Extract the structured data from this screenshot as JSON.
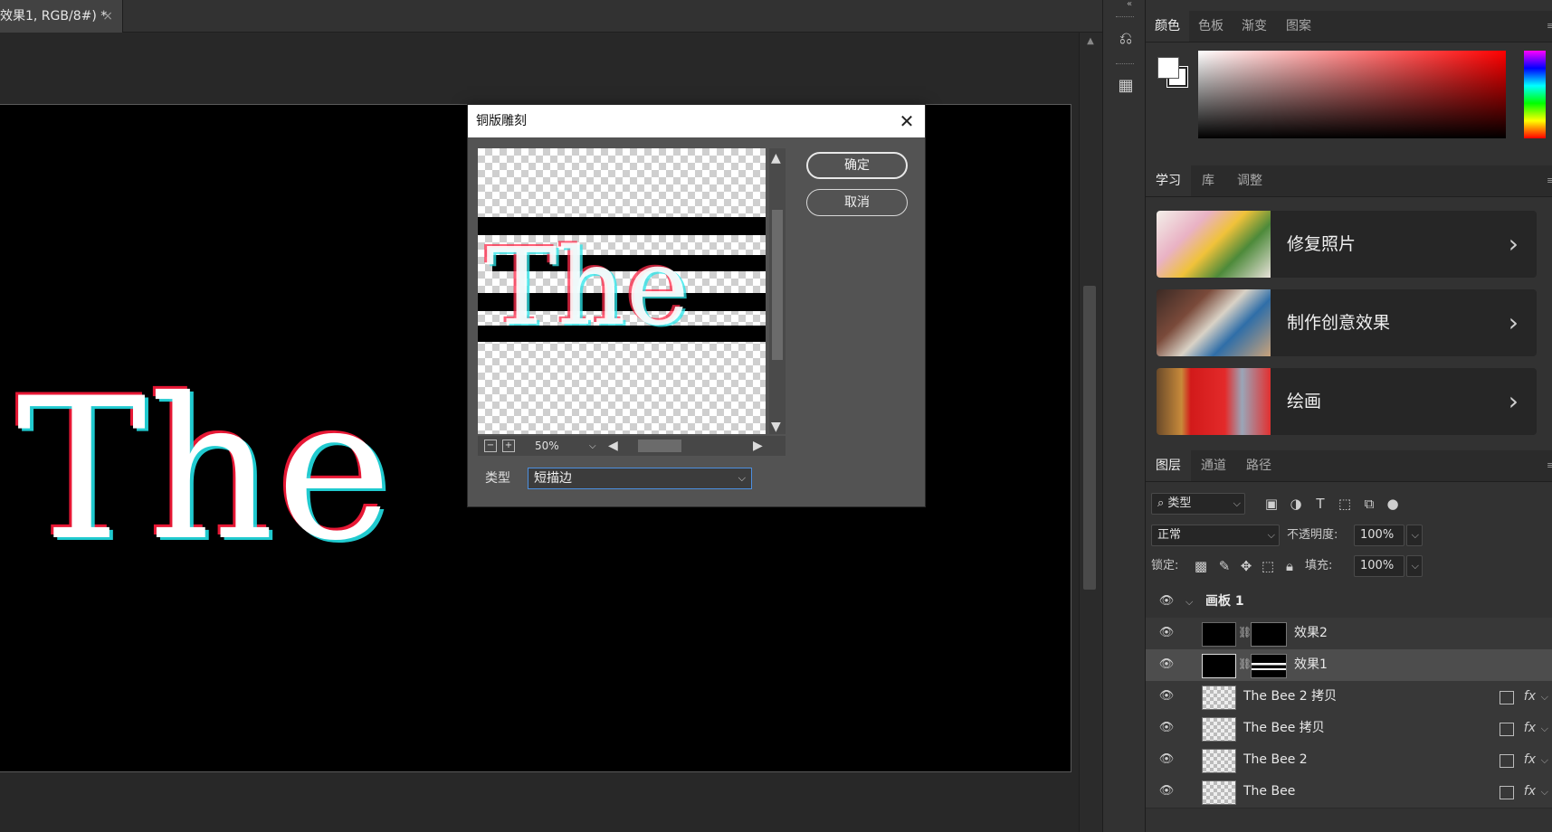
{
  "document": {
    "tab_title": "效果1, RGB/8#) *",
    "tab_close": "×",
    "canvas_text": "The"
  },
  "dialog": {
    "title": "铜版雕刻",
    "close_glyph": "✕",
    "ok_label": "确定",
    "cancel_label": "取消",
    "zoom": "50%",
    "type_label": "类型",
    "type_value": "短描边",
    "preview_text": "The"
  },
  "color_panel": {
    "tabs": [
      "颜色",
      "色板",
      "渐变",
      "图案"
    ],
    "foreground": "#ffffff",
    "background": "#ffffff"
  },
  "learn_panel": {
    "tabs": [
      "学习",
      "库",
      "调整"
    ],
    "cards": [
      {
        "label": "修复照片",
        "icon": "flower-bouquet-thumbnail"
      },
      {
        "label": "制作创意效果",
        "icon": "creative-desk-thumbnail"
      },
      {
        "label": "绘画",
        "icon": "fish-painting-thumbnail"
      }
    ]
  },
  "layers_panel": {
    "tabs": [
      "图层",
      "通道",
      "路径"
    ],
    "filter_label": "类型",
    "blend_mode": "正常",
    "opacity_label": "不透明度:",
    "opacity_value": "100%",
    "lock_label": "锁定:",
    "fill_label": "填充:",
    "fill_value": "100%",
    "group": {
      "name": "画板 1"
    },
    "layers": [
      {
        "name": "效果2",
        "selected": false,
        "has_mask": true,
        "fx": false
      },
      {
        "name": "效果1",
        "selected": true,
        "has_mask": true,
        "fx": false
      },
      {
        "name": "The Bee 2 拷贝",
        "selected": false,
        "has_mask": false,
        "fx": true
      },
      {
        "name": "The Bee 拷贝",
        "selected": false,
        "has_mask": false,
        "fx": true
      },
      {
        "name": "The Bee 2",
        "selected": false,
        "has_mask": false,
        "fx": true
      },
      {
        "name": "The Bee",
        "selected": false,
        "has_mask": false,
        "fx": true
      }
    ],
    "fx_glyph": "fx"
  },
  "colors": {
    "accent_blue": "#4c8fe0",
    "glitch_red": "#ff1a3a",
    "glitch_cyan": "#24e0e6"
  }
}
